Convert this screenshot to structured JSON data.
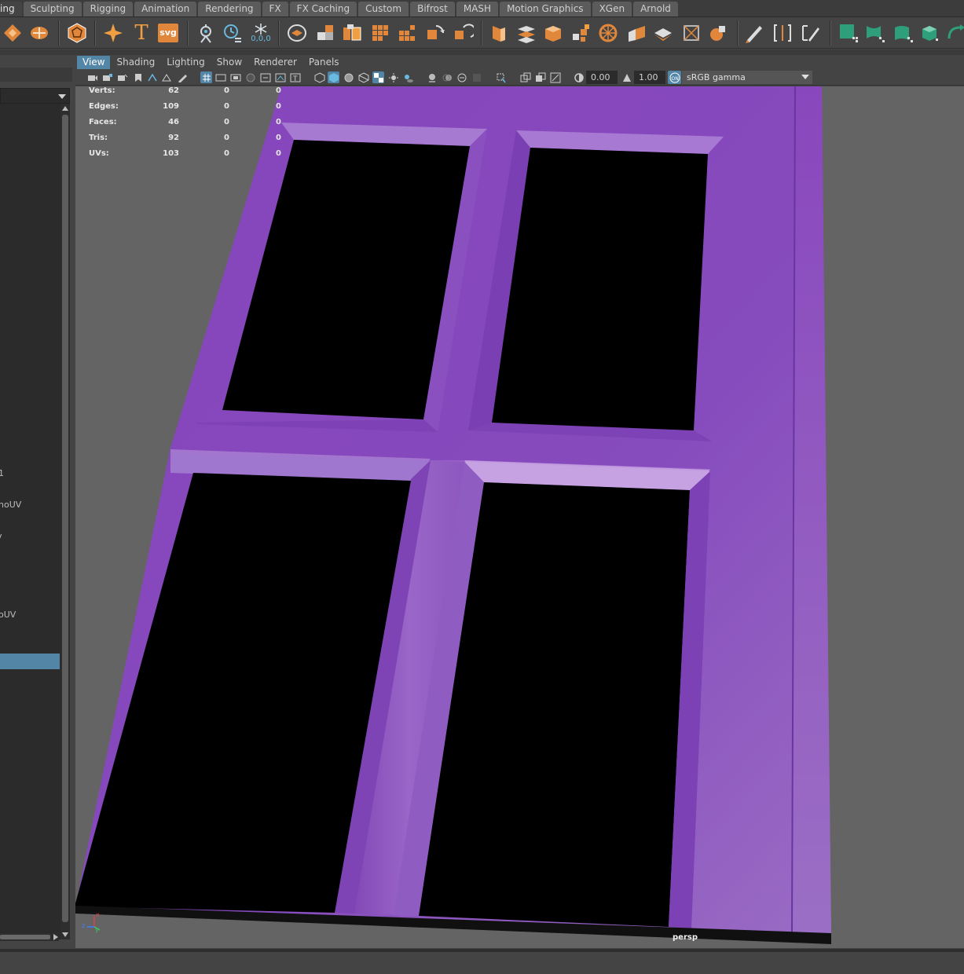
{
  "shelf": {
    "tabs": [
      "ing",
      "Sculpting",
      "Rigging",
      "Animation",
      "Rendering",
      "FX",
      "FX Caching",
      "Custom",
      "Bifrost",
      "MASH",
      "Motion Graphics",
      "XGen",
      "Arnold"
    ],
    "origin_label": "0,0,0",
    "text_tool_label": "T",
    "svg_tool_label": "svg"
  },
  "outliner": {
    "items": [
      "1",
      "hoUV",
      "v",
      "oUV"
    ],
    "selected_index": 4
  },
  "viewport": {
    "menu": [
      "View",
      "Shading",
      "Lighting",
      "Show",
      "Renderer",
      "Panels"
    ],
    "active_menu": "View",
    "toolbar": {
      "exposure": "0.00",
      "gamma": "1.00",
      "color_space": "sRGB gamma"
    },
    "hud": {
      "rows": [
        {
          "label": "Verts:",
          "a": "62",
          "b": "0",
          "c": "0"
        },
        {
          "label": "Edges:",
          "a": "109",
          "b": "0",
          "c": "0"
        },
        {
          "label": "Faces:",
          "a": "46",
          "b": "0",
          "c": "0"
        },
        {
          "label": "Tris:",
          "a": "92",
          "b": "0",
          "c": "0"
        },
        {
          "label": "UVs:",
          "a": "103",
          "b": "0",
          "c": "0"
        }
      ]
    },
    "camera_label": "persp",
    "axis": {
      "x": "x",
      "y": "y",
      "z": "z"
    },
    "colors": {
      "frame_purple": "#8a4bc0",
      "frame_dark": "#7d40b6",
      "bevel_light": "#c49ae0",
      "glass": "#000000",
      "background": "#646464",
      "selection_blue": "#5285a6"
    }
  }
}
